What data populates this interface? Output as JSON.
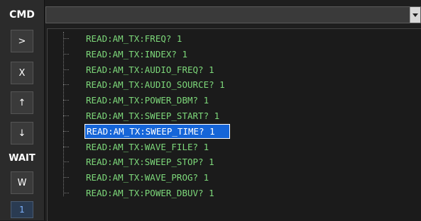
{
  "sidebar": {
    "header": "CMD",
    "buttons": [
      {
        "label": ">",
        "name": "execute-button"
      },
      {
        "label": "X",
        "name": "clear-button"
      },
      {
        "label": "↑",
        "name": "move-up-button"
      },
      {
        "label": "↓",
        "name": "move-down-button"
      }
    ],
    "wait_label": "WAIT",
    "wait_button": "W",
    "counter": "1"
  },
  "dropdown": {
    "value": "",
    "arrow_icon": "chevron-down-icon"
  },
  "tree": {
    "items": [
      "READ:AM_TX:FREQ? 1",
      "READ:AM_TX:INDEX? 1",
      "READ:AM_TX:AUDIO_FREQ? 1",
      "READ:AM_TX:AUDIO_SOURCE? 1",
      "READ:AM_TX:POWER_DBM? 1",
      "READ:AM_TX:SWEEP_START? 1",
      "READ:AM_TX:SWEEP_TIME? 1",
      "READ:AM_TX:WAVE_FILE? 1",
      "READ:AM_TX:SWEEP_STOP? 1",
      "READ:AM_TX:WAVE_PROG? 1",
      "READ:AM_TX:POWER_DBUV? 1"
    ],
    "selected_index": 6
  },
  "colors": {
    "item_text": "#7dd87a",
    "selection": "#1565d8",
    "background": "#1b1b1b"
  }
}
